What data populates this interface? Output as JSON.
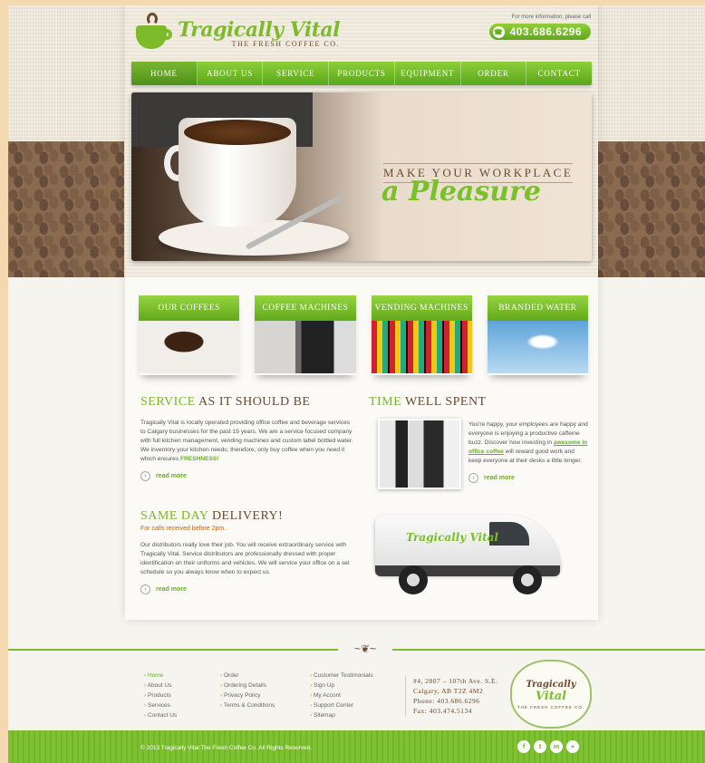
{
  "brand": {
    "name": "Tragically Vital",
    "tagline": "THE FRESH COFFEE CO.",
    "contact_note": "For more information, please call",
    "phone": "403.686.6296"
  },
  "nav": {
    "items": [
      {
        "label": "HOME",
        "active": true
      },
      {
        "label": "ABOUT US"
      },
      {
        "label": "SERVICE"
      },
      {
        "label": "PRODUCTS"
      },
      {
        "label": "EQUIPMENT"
      },
      {
        "label": "ORDER"
      },
      {
        "label": "CONTACT"
      }
    ]
  },
  "hero": {
    "line1": "Make your workplace",
    "line2": "a Pleasure"
  },
  "categories": [
    {
      "label": "Our Coffees"
    },
    {
      "label": "Coffee Machines"
    },
    {
      "label": "Vending Machines"
    },
    {
      "label": "Branded Water"
    }
  ],
  "service": {
    "title_highlight": "Service",
    "title_rest": " as it should be",
    "body": "Tragically Vital is locally operated providing office coffee and beverage services to Calgary businesses for the past 15 years. We are a service focused company with full kitchen management, vending machines and custom label bottled water. We inventory your kitchen needs; therefore, only buy coffee when you need it which ensures ",
    "body_highlight": "FRESHNESS!",
    "read_more": "read more"
  },
  "time": {
    "title_highlight": "Time",
    "title_rest": " well spent",
    "body1": "You're happy, your employees are happy and everyone is enjoying a productive caffeine buzz. Discover how investing in ",
    "body_highlight": "awesome in office coffee",
    "body2": " will reward good work and keep everyone at their desks a little longer.",
    "read_more": "read more"
  },
  "delivery": {
    "title_highlight": "Same day",
    "title_rest": " delivery!",
    "subtitle": "For calls received before 2pm.",
    "body": "Our distributors really love their job. You will receive extraordinary service with Tragically Vital. Service distributors are professionally dressed with proper identification on their uniforms and vehicles. We will service your office on a set schedule so you always know when to expect us.",
    "read_more": "read more",
    "van_logo": "Tragically Vital"
  },
  "footer": {
    "col1": [
      "Home",
      "About Us",
      "Products",
      "Services",
      "Contact Us"
    ],
    "col2": [
      "Order",
      "Ordering Details",
      "Privacy Policy",
      "Terms & Conditions"
    ],
    "col3": [
      "Customer Testimonials",
      "Sign Up",
      "My Accont",
      "Support Center",
      "Sitemap"
    ],
    "address": [
      "#4, 2807 – 107th Ave. S.E.",
      "Calgary, AB T2Z 4M2",
      "Phone: 403.686.6296",
      "Fax: 403.474.5134"
    ],
    "badge_line1": "Tragically",
    "badge_line2": "Vital",
    "badge_line3": "THE FRESH COFFEE CO."
  },
  "bottom": {
    "copyright": "© 2013 Tragically Vital The Fresh Coffee Co. All Rights Reserved.",
    "social": [
      {
        "icon": "facebook-icon",
        "glyph": "f"
      },
      {
        "icon": "twitter-icon",
        "glyph": "t"
      },
      {
        "icon": "linkedin-icon",
        "glyph": "in"
      },
      {
        "icon": "rss-icon",
        "glyph": "⌁"
      }
    ]
  },
  "colors": {
    "accent": "#7dbb2b",
    "brown": "#6b4a2d",
    "page_bg": "#f4d9b0"
  }
}
